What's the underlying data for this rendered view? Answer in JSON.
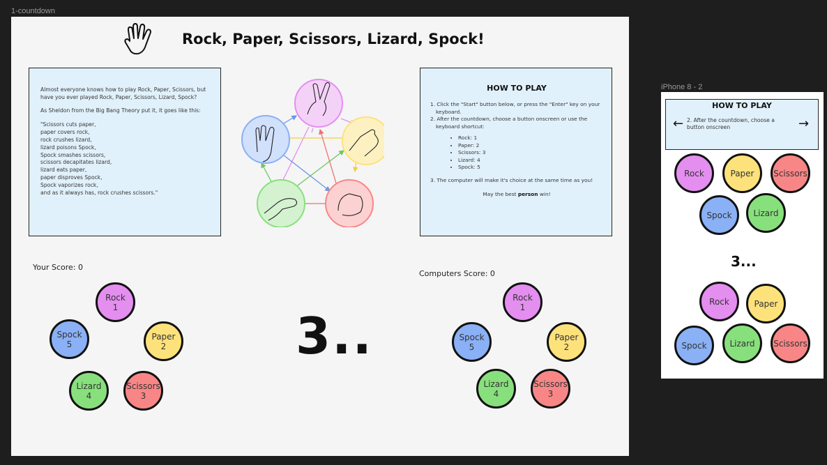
{
  "desktop": {
    "label": "1-countdown",
    "title": "Rock, Paper, Scissors, Lizard, Spock!",
    "logo_icon": "spock-hand-icon",
    "intro": {
      "p1": "Almost everyone knows how to play Rock, Paper, Scissors, but have you ever played Rock, Paper, Scissors, Lizard, Spock?",
      "p2": "As Sheldon from the Big Bang Theory put it, it goes like this:",
      "quote": [
        "\"Scissors cuts paper,",
        "paper covers rock,",
        "rock crushes lizard,",
        "lizard poisons Spock,",
        "Spock smashes scissors,",
        "scissors decapitates lizard,",
        "lizard eats paper,",
        "paper disproves Spock,",
        "Spock vaporizes rock,",
        "and as it always has, rock crushes scissors.\""
      ]
    },
    "diagram": {
      "icons": [
        "scissors-hand-icon",
        "paper-hand-icon",
        "rock-fist-icon",
        "lizard-hand-icon",
        "spock-hand-icon"
      ]
    },
    "how_to_play": {
      "title": "HOW TO PLAY",
      "step1": "1. Click the \"Start\" button below, or press the \"Enter\" key on your keyboard.",
      "step2": "2. After the countdown, choose a button onscreen or use the keyboard shortcut:",
      "shortcuts": [
        "Rock: 1",
        "Paper: 2",
        "Scissors: 3",
        "Lizard: 4",
        "Spock: 5"
      ],
      "step3": "3.  The computer will make it's choice at the same time as you!",
      "closing_pre": "May the best ",
      "closing_bold": "person",
      "closing_post": " win!"
    },
    "your_score": "Your Score: 0",
    "computer_score": "Computers Score: 0",
    "countdown": "3..",
    "player_buttons": {
      "rock": {
        "name": "Rock",
        "key": "1"
      },
      "paper": {
        "name": "Paper",
        "key": "2"
      },
      "scissors": {
        "name": "Scissors",
        "key": "3"
      },
      "lizard": {
        "name": "Lizard",
        "key": "4"
      },
      "spock": {
        "name": "Spock",
        "key": "5"
      }
    },
    "computer_buttons": {
      "rock": {
        "name": "Rock",
        "key": "1"
      },
      "paper": {
        "name": "Paper",
        "key": "2"
      },
      "scissors": {
        "name": "Scissors",
        "key": "3"
      },
      "lizard": {
        "name": "Lizard",
        "key": "4"
      },
      "spock": {
        "name": "Spock",
        "key": "5"
      }
    }
  },
  "mobile": {
    "label": "iPhone 8 - 2",
    "how_to_play_title": "HOW TO PLAY",
    "step_text": "2. After the countdown, choose a button onscreen",
    "countdown": "3...",
    "player_buttons": {
      "rock": "Rock",
      "paper": "Paper",
      "scissors": "Scissors",
      "spock": "Spock",
      "lizard": "Lizard"
    },
    "computer_buttons": {
      "rock": "Rock",
      "paper": "Paper",
      "spock": "Spock",
      "lizard": "Lizard",
      "scissors": "Scissors"
    }
  },
  "colors": {
    "rock": "#e48ef0",
    "paper": "#fde27b",
    "scissors": "#f98686",
    "lizard": "#88e07d",
    "spock": "#8ab0f5",
    "panel": "#e1f1fb",
    "frame": "#f5f5f5",
    "canvas": "#1e1e1e"
  }
}
